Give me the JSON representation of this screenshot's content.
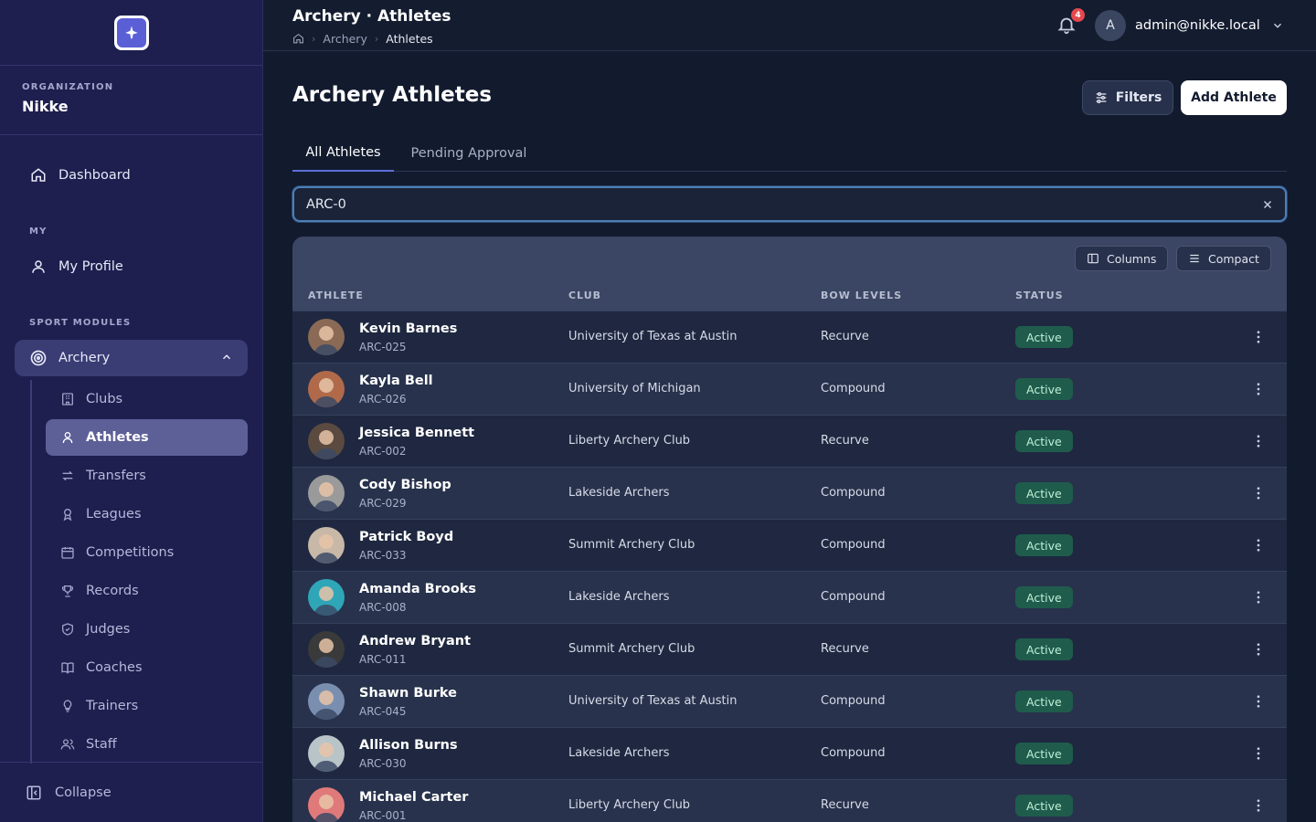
{
  "sidebar": {
    "org_label": "ORGANIZATION",
    "org_name": "Nikke",
    "dashboard": "Dashboard",
    "my_section": "MY",
    "my_profile": "My Profile",
    "sport_section": "SPORT MODULES",
    "archery": "Archery",
    "sub_items": [
      {
        "label": "Clubs",
        "icon": "building-icon"
      },
      {
        "label": "Athletes",
        "icon": "user-icon"
      },
      {
        "label": "Transfers",
        "icon": "transfer-icon"
      },
      {
        "label": "Leagues",
        "icon": "award-icon"
      },
      {
        "label": "Competitions",
        "icon": "calendar-icon"
      },
      {
        "label": "Records",
        "icon": "trophy-icon"
      },
      {
        "label": "Judges",
        "icon": "shield-icon"
      },
      {
        "label": "Coaches",
        "icon": "book-icon"
      },
      {
        "label": "Trainers",
        "icon": "lightbulb-icon"
      },
      {
        "label": "Staff",
        "icon": "users-icon"
      }
    ],
    "collapse": "Collapse"
  },
  "header": {
    "title": "Archery · Athletes",
    "breadcrumb": [
      "Archery",
      "Athletes"
    ],
    "notification_count": "4",
    "user_initial": "A",
    "user_email": "admin@nikke.local"
  },
  "main": {
    "page_title": "Archery Athletes",
    "filters_label": "Filters",
    "add_label": "Add Athlete",
    "tabs": [
      "All Athletes",
      "Pending Approval"
    ],
    "search_value": "ARC-0"
  },
  "table": {
    "columns_label": "Columns",
    "compact_label": "Compact",
    "headers": [
      "ATHLETE",
      "CLUB",
      "BOW LEVELS",
      "STATUS"
    ],
    "rows": [
      {
        "name": "Kevin Barnes",
        "id": "ARC-025",
        "club": "University of Texas at Austin",
        "bow": "Recurve",
        "status": "Active",
        "avatar_color": "#8a6a55"
      },
      {
        "name": "Kayla Bell",
        "id": "ARC-026",
        "club": "University of Michigan",
        "bow": "Compound",
        "status": "Active",
        "avatar_color": "#b06a4a"
      },
      {
        "name": "Jessica Bennett",
        "id": "ARC-002",
        "club": "Liberty Archery Club",
        "bow": "Recurve",
        "status": "Active",
        "avatar_color": "#5a4a40"
      },
      {
        "name": "Cody Bishop",
        "id": "ARC-029",
        "club": "Lakeside Archers",
        "bow": "Compound",
        "status": "Active",
        "avatar_color": "#9a9a9a"
      },
      {
        "name": "Patrick Boyd",
        "id": "ARC-033",
        "club": "Summit Archery Club",
        "bow": "Compound",
        "status": "Active",
        "avatar_color": "#c7b8a8"
      },
      {
        "name": "Amanda Brooks",
        "id": "ARC-008",
        "club": "Lakeside Archers",
        "bow": "Compound",
        "status": "Active",
        "avatar_color": "#2fa6b8"
      },
      {
        "name": "Andrew Bryant",
        "id": "ARC-011",
        "club": "Summit Archery Club",
        "bow": "Recurve",
        "status": "Active",
        "avatar_color": "#3a3a3a"
      },
      {
        "name": "Shawn Burke",
        "id": "ARC-045",
        "club": "University of Texas at Austin",
        "bow": "Compound",
        "status": "Active",
        "avatar_color": "#7a8fb0"
      },
      {
        "name": "Allison Burns",
        "id": "ARC-030",
        "club": "Lakeside Archers",
        "bow": "Compound",
        "status": "Active",
        "avatar_color": "#b8c4c8"
      },
      {
        "name": "Michael Carter",
        "id": "ARC-001",
        "club": "Liberty Archery Club",
        "bow": "Recurve",
        "status": "Active",
        "avatar_color": "#e07a7a"
      }
    ]
  }
}
